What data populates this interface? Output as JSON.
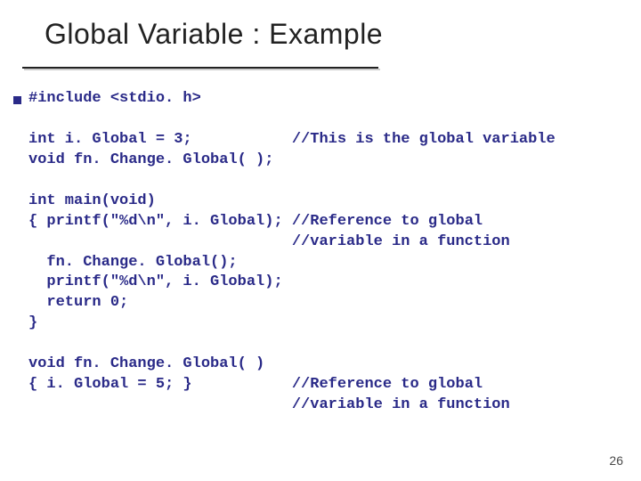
{
  "title": "Global Variable : Example",
  "code": {
    "l1": "#include <stdio. h>",
    "l2": "",
    "l3a": "int i. Global = 3;",
    "l3b": "//This is the global variable",
    "l4": "void fn. Change. Global( );",
    "l5": "",
    "l6": "int main(void)",
    "l7a": "{ printf(\"%d\\n\", i. Global);",
    "l7b": "//Reference to global",
    "l8": "                             //variable in a function",
    "l9": "  fn. Change. Global();",
    "l10": "  printf(\"%d\\n\", i. Global);",
    "l11": "  return 0;",
    "l12": "}",
    "l13": "",
    "l14": "void fn. Change. Global( )",
    "l15a": "{ i. Global = 5; }",
    "l15b": "//Reference to global",
    "l16": "                             //variable in a function"
  },
  "page_number": "26"
}
